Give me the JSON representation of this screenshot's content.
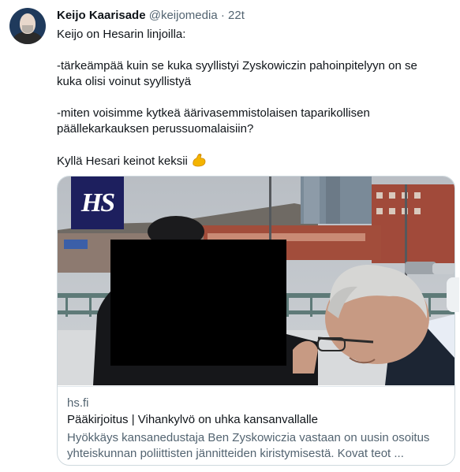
{
  "author": {
    "name": "Keijo Kaarisade",
    "handle": "@keijomedia",
    "separator": "·",
    "time": "22t"
  },
  "tweet": {
    "line1": "Keijo on Hesarin linjoilla:",
    "para1": "-tärkeämpää kuin se kuka syyllistyi Zyskowiczin pahoinpitelyyn on se kuka olisi voinut syyllistyä",
    "para2": "-miten voisimme kytkeä äärivasemmistolaisen taparikollisen päällekarkauksen perussuomalaisiin?",
    "closing": "Kyllä Hesari keinot keksii",
    "emoji": "flexed-biceps-icon"
  },
  "card": {
    "logo": "HS",
    "domain": "hs.fi",
    "title": "Pääkirjoitus | Vihankylvö on uhka kansanvallalle",
    "description": "Hyökkäys kansanedustaja Ben Zyskowiczia vastaan on uusin osoitus yhteiskunnan poliittisten jännitteiden kiristymisestä. Kovat teot ..."
  },
  "colors": {
    "logo_bg": "#1d1f5e",
    "secondary_text": "#536471",
    "border": "#cfd9de"
  }
}
